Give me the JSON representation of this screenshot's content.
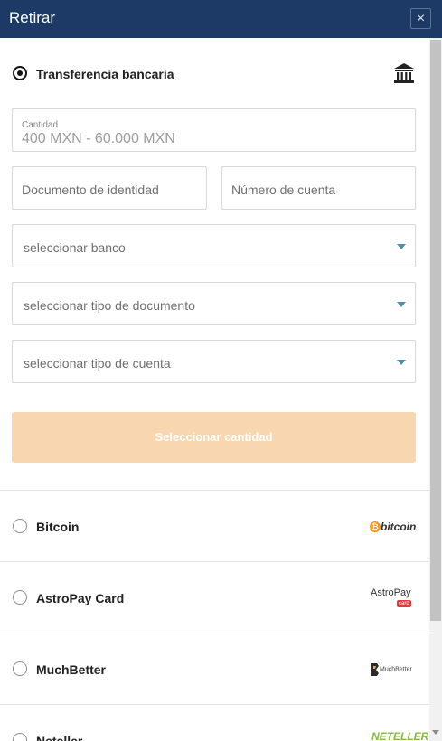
{
  "header": {
    "title": "Retirar",
    "close_glyph": "×"
  },
  "methods": {
    "bank": {
      "label": "Transferencia bancaria",
      "icon": "bank-icon",
      "selected": true,
      "form": {
        "amount_label": "Cantidad",
        "amount_placeholder": "400 MXN - 60.000 MXN",
        "id_document_placeholder": "Documento de identidad",
        "account_number_placeholder": "Número de cuenta",
        "bank_select": "seleccionar banco",
        "document_type_select": "seleccionar tipo de documento",
        "account_type_select": "seleccionar tipo de cuenta",
        "submit_label": "Seleccionar cantidad"
      }
    },
    "bitcoin": {
      "label": "Bitcoin",
      "logo_text": "bitcoin",
      "logo_symbol": "₿"
    },
    "astropay": {
      "label": "AstroPay Card",
      "logo_text": "AstroPay",
      "logo_sub": "card"
    },
    "muchbetter": {
      "label": "MuchBetter",
      "logo_text": "MuchBetter"
    },
    "neteller": {
      "label": "Neteller",
      "logo_text": "NETELLER"
    }
  },
  "colors": {
    "header_bg": "#1d3a67",
    "submit_disabled_bg": "#f8d7b0",
    "caret": "#4d8cb5",
    "bitcoin": "#f7931a",
    "neteller": "#83ba3b"
  }
}
